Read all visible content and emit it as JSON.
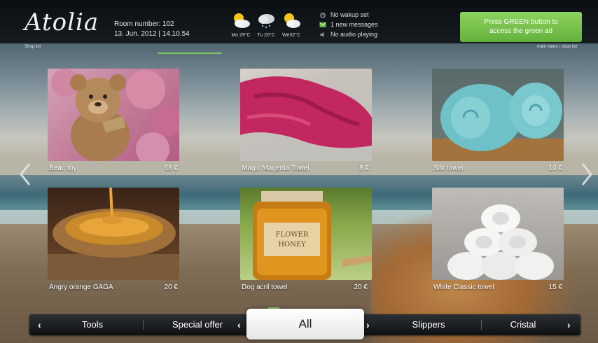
{
  "header": {
    "logo": "Atolia",
    "room_number": "Room number: 102",
    "datetime": "13. Jun. 2012 | 14.10.54",
    "weather": [
      {
        "label": "Mo 29°C",
        "icon": "sun-cloud-icon"
      },
      {
        "label": "Tu 20°C",
        "icon": "rain-cloud-icon"
      },
      {
        "label": "We32°C",
        "icon": "sun-cloud-icon"
      }
    ],
    "status": {
      "wakeup": "No wakup set",
      "messages": "1 new messages",
      "audio": "No audio playing"
    },
    "green_ad": "Press GREEN button to access the green ad",
    "green_color": "#6cbf44"
  },
  "breadcrumb": {
    "left": "Shop list",
    "right": "main menu › shop list"
  },
  "products": [
    {
      "name": "Bear, toy",
      "price": "58 €",
      "image": "teddy-bear-image"
    },
    {
      "name": "Magic Magenta Towel",
      "price": "8 €",
      "image": "magenta-towel-image"
    },
    {
      "name": "Silk towel",
      "price": "10 €",
      "image": "rolled-blue-towels-image"
    },
    {
      "name": "Angry orange GAGA",
      "price": "20 €",
      "image": "honey-bowl-image"
    },
    {
      "name": "Dog acril towel",
      "price": "20 €",
      "image": "honey-jar-image",
      "jar_label": "FLOWER HONEY"
    },
    {
      "name": "White Classic towel",
      "price": "15 €",
      "image": "white-towels-stack-image"
    }
  ],
  "categories": {
    "items": [
      "Tools",
      "Special offer",
      "Slippers",
      "Cristal"
    ],
    "active": "All"
  },
  "accent_color": "#7fc45a"
}
